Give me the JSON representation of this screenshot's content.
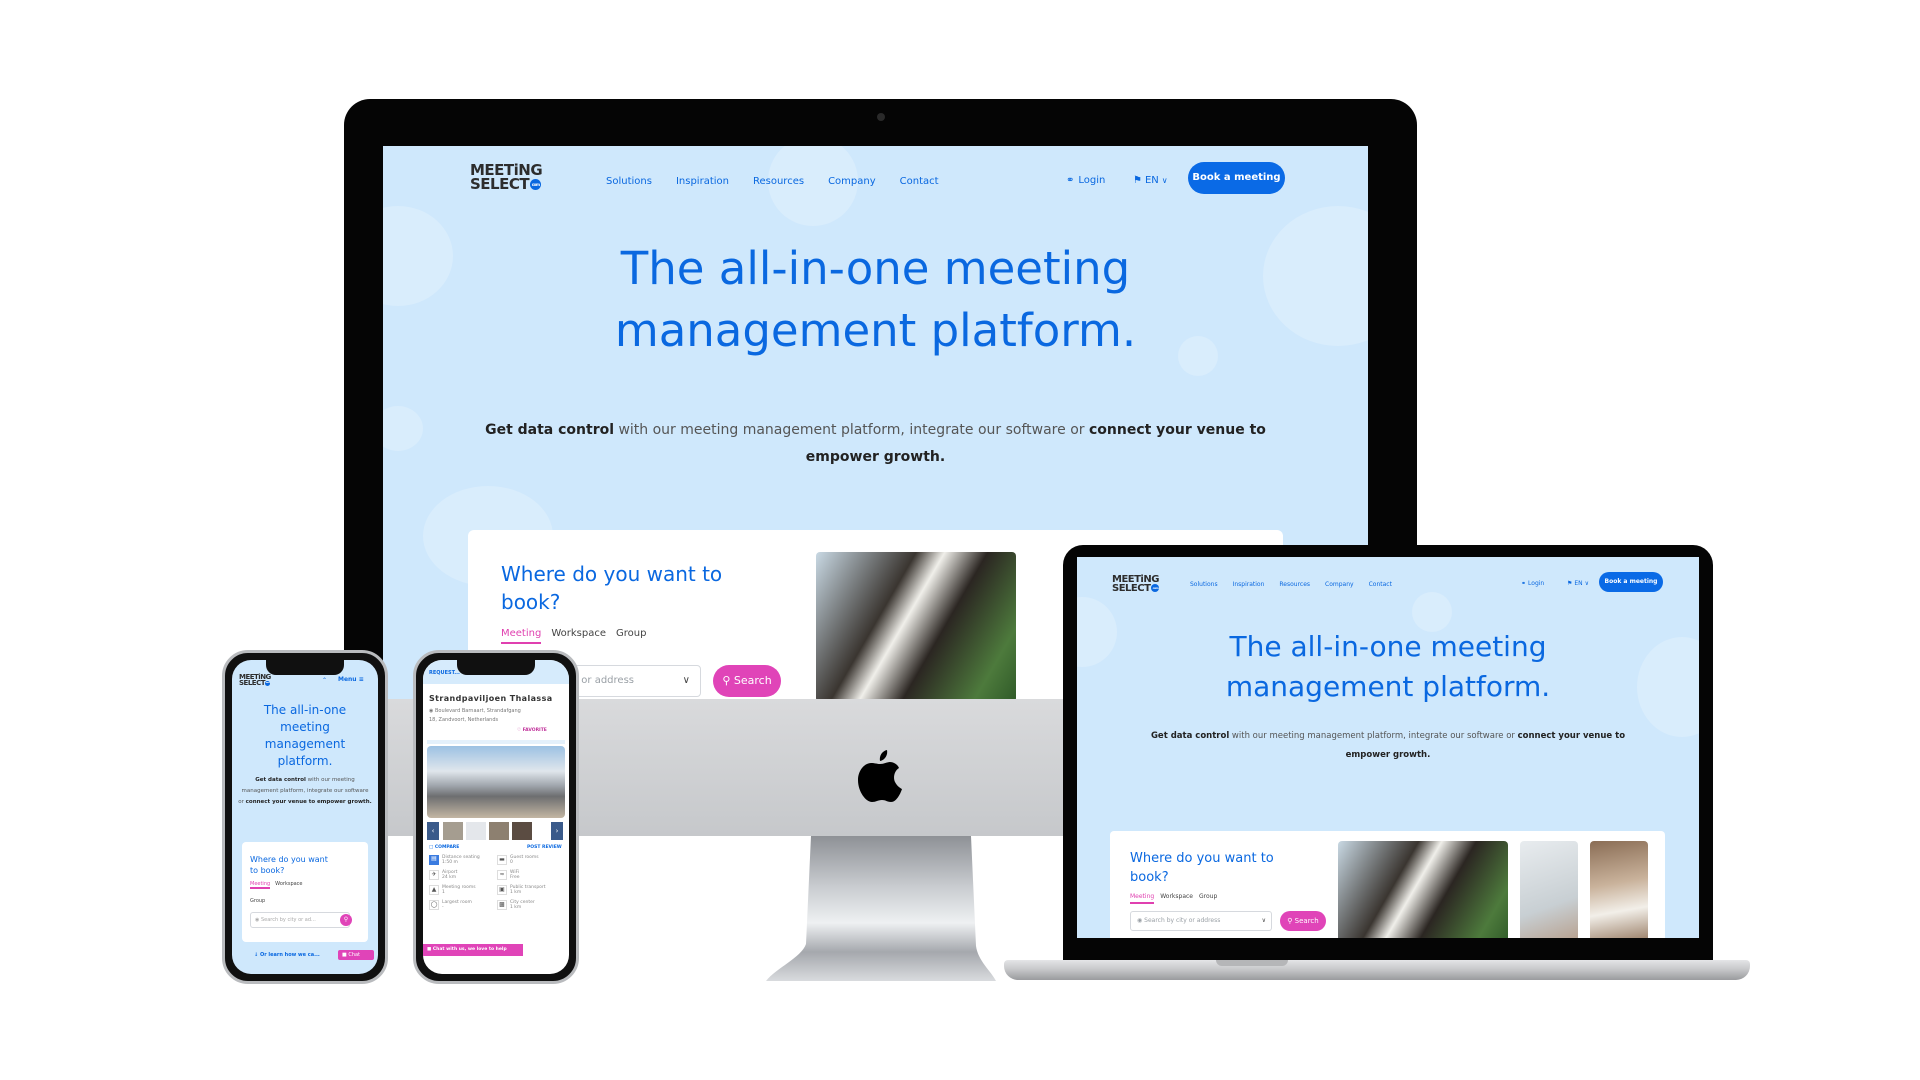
{
  "site": {
    "logo_line1": "MEETiNG",
    "logo_line2": "SELECT",
    "logo_badge": "com",
    "nav": [
      "Solutions",
      "Inspiration",
      "Resources",
      "Company",
      "Contact"
    ],
    "login": "Login",
    "language": "EN",
    "book_button": "Book a meeting",
    "mobile_menu": "Menu",
    "hero_title_line1": "The all-in-one meeting",
    "hero_title_line2": "management platform.",
    "hero_sub": {
      "bold1": "Get data control",
      "mid": " with our meeting management platform, integrate our software or ",
      "bold2": "connect your venue to",
      "bold3": "empower growth."
    },
    "search_card": {
      "title_line1": "Where do you want to",
      "title_line2": "book?",
      "tabs": [
        "Meeting",
        "Workspace",
        "Group"
      ],
      "active_tab": "Meeting",
      "input_placeholder": "Search by city or address",
      "input_placeholder_partial": "city or address",
      "mobile_placeholder": "Search by city or ad...",
      "search_button": "Search"
    },
    "learn_more": "Or learn how we ca...",
    "chat_label": "Chat"
  },
  "venue_page": {
    "top_label": "REQUEST...",
    "venue_name": "Strandpaviljoen Thalassa",
    "address_line1": "Boulevard Barnaart, Strandafgang",
    "address_line2": "18, Zandvoort, Netherlands",
    "favorite": "FAVORITE",
    "compare": "COMPARE",
    "post_review": "POST REVIEW",
    "facts": [
      {
        "label": "Distance seating",
        "value": "1:50 m",
        "icon": "seating-icon"
      },
      {
        "label": "Guest rooms",
        "value": "0",
        "icon": "bed-icon"
      },
      {
        "label": "Airport",
        "value": "24 km",
        "icon": "airplane-icon"
      },
      {
        "label": "WiFi",
        "value": "Free",
        "icon": "wifi-icon"
      },
      {
        "label": "Meeting rooms",
        "value": "1",
        "icon": "meeting-room-icon"
      },
      {
        "label": "Public transport",
        "value": "1 km",
        "icon": "train-icon"
      },
      {
        "label": "Largest room",
        "value": "-",
        "icon": "room-size-icon"
      },
      {
        "label": "City center",
        "value": "1 km",
        "icon": "city-icon"
      }
    ],
    "chat_banner": "Chat with us, we love to help"
  },
  "colors": {
    "brand_blue": "#0a68e0",
    "accent_pink": "#e044b8",
    "hero_background": "#cfe8fc"
  }
}
